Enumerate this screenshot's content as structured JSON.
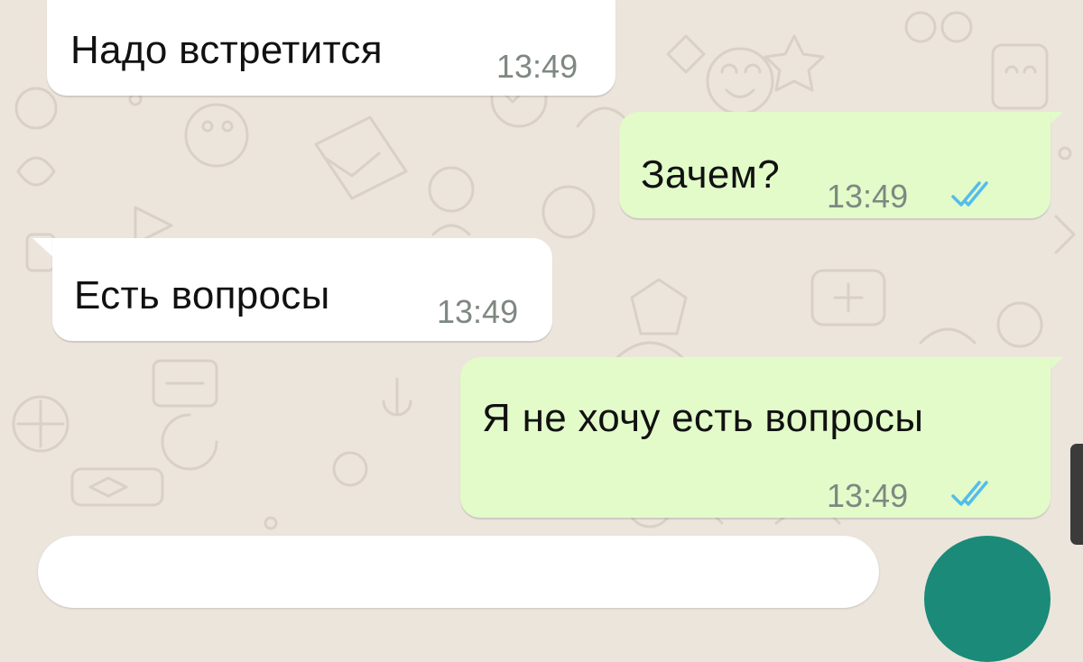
{
  "chat": {
    "messages": [
      {
        "direction": "incoming",
        "text": "Надо встретится",
        "time": "13:49"
      },
      {
        "direction": "outgoing",
        "text": "Зачем?",
        "time": "13:49",
        "status": "read",
        "status_icon": "double-check-icon"
      },
      {
        "direction": "incoming",
        "text": "Есть вопросы",
        "time": "13:49"
      },
      {
        "direction": "outgoing",
        "text": "Я не хочу есть вопросы",
        "time": "13:49",
        "status": "read",
        "status_icon": "double-check-icon"
      }
    ]
  },
  "colors": {
    "wallpaper": "#ece5dc",
    "incoming_bubble": "#ffffff",
    "outgoing_bubble": "#e2fbc9",
    "read_ticks": "#53bdeb",
    "send_button": "#1b8a78"
  }
}
